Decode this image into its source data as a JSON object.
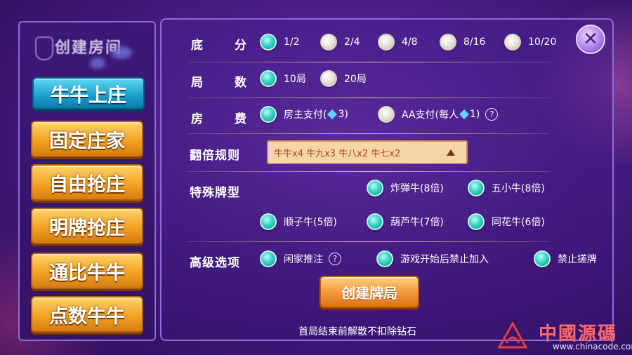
{
  "left_panel": {
    "header_title": "创建房间",
    "modes": [
      {
        "label": "牛牛上庄",
        "active": true
      },
      {
        "label": "固定庄家",
        "active": false
      },
      {
        "label": "自由抢庄",
        "active": false
      },
      {
        "label": "明牌抢庄",
        "active": false
      },
      {
        "label": "通比牛牛",
        "active": false
      },
      {
        "label": "点数牛牛",
        "active": false
      }
    ]
  },
  "settings": {
    "base_score": {
      "label_a": "底",
      "label_b": "分",
      "options": [
        "1/2",
        "2/4",
        "4/8",
        "8/16",
        "10/20"
      ],
      "selected": "1/2"
    },
    "rounds": {
      "label_a": "局",
      "label_b": "数",
      "options": [
        "10局",
        "20局"
      ],
      "selected": "10局"
    },
    "room_fee": {
      "label_a": "房",
      "label_b": "费",
      "option_owner_pre": "房主支付(",
      "option_owner_post": "3)",
      "option_aa_pre": "AA支付(每人",
      "option_aa_post": "1)",
      "help": "?"
    },
    "multiplier_rule": {
      "label": "翻倍规则",
      "value": "牛牛x4 牛九x3 牛八x2 牛七x2"
    },
    "special_hands": {
      "label": "特殊牌型",
      "options": [
        "炸弹牛(8倍)",
        "五小牛(8倍)",
        "顺子牛(5倍)",
        "葫芦牛(7倍)",
        "同花牛(6倍)"
      ]
    },
    "advanced": {
      "label": "高级选项",
      "options": [
        "闲家推注",
        "游戏开始后禁止加入",
        "禁止搓牌"
      ],
      "help": "?"
    }
  },
  "create_button": "创建牌局",
  "footer_note": "首局结束前解散不扣除钻石",
  "close_symbol": "✕",
  "watermark": {
    "title": "中國源碼",
    "url": "www.chinacode.com"
  },
  "colors": {
    "accent_teal": "#39d4c8",
    "button_orange": "#f2a324",
    "active_blue": "#1ea3cf",
    "background_purple": "#4a1e86"
  }
}
